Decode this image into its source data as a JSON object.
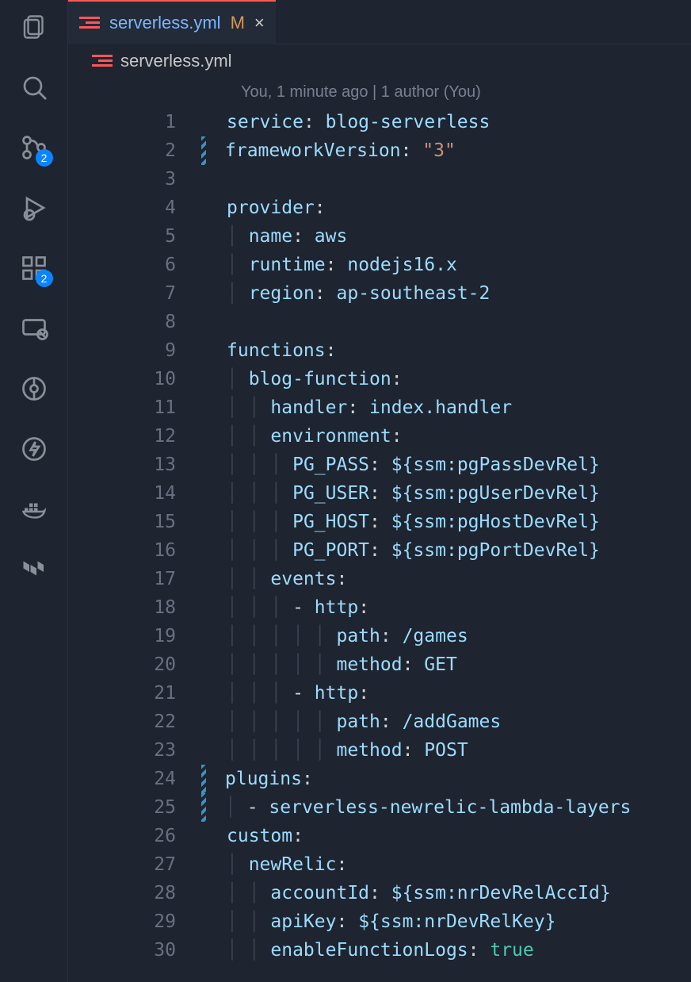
{
  "tab": {
    "filename": "serverless.yml",
    "modified_badge": "M",
    "close_glyph": "×"
  },
  "breadcrumb": {
    "filename": "serverless.yml"
  },
  "activity": {
    "scm_badge": "2",
    "ext_badge": "2"
  },
  "codelens": "You, 1 minute ago | 1 author (You)",
  "code": {
    "line1": [
      [
        "key",
        "service"
      ],
      [
        "punc",
        ": "
      ],
      [
        "plain",
        "blog-serverless"
      ]
    ],
    "line2": [
      [
        "key",
        "frameworkVersion"
      ],
      [
        "punc",
        ": "
      ],
      [
        "str",
        "\"3\""
      ]
    ],
    "line3": [],
    "line4": [
      [
        "key",
        "provider"
      ],
      [
        "punc",
        ":"
      ]
    ],
    "line5": [
      [
        "indent",
        "  "
      ],
      [
        "key",
        "name"
      ],
      [
        "punc",
        ": "
      ],
      [
        "plain",
        "aws"
      ]
    ],
    "line6": [
      [
        "indent",
        "  "
      ],
      [
        "key",
        "runtime"
      ],
      [
        "punc",
        ": "
      ],
      [
        "plain",
        "nodejs16.x"
      ]
    ],
    "line7": [
      [
        "indent",
        "  "
      ],
      [
        "key",
        "region"
      ],
      [
        "punc",
        ": "
      ],
      [
        "plain",
        "ap-southeast-2"
      ]
    ],
    "line8": [],
    "line9": [
      [
        "key",
        "functions"
      ],
      [
        "punc",
        ":"
      ]
    ],
    "line10": [
      [
        "indent",
        "  "
      ],
      [
        "key",
        "blog-function"
      ],
      [
        "punc",
        ":"
      ]
    ],
    "line11": [
      [
        "indent",
        "    "
      ],
      [
        "key",
        "handler"
      ],
      [
        "punc",
        ": "
      ],
      [
        "plain",
        "index.handler"
      ]
    ],
    "line12": [
      [
        "indent",
        "    "
      ],
      [
        "key",
        "environment"
      ],
      [
        "punc",
        ":"
      ]
    ],
    "line13": [
      [
        "indent",
        "      "
      ],
      [
        "key",
        "PG_PASS"
      ],
      [
        "punc",
        ": "
      ],
      [
        "ssm",
        "${ssm:pgPassDevRel}"
      ]
    ],
    "line14": [
      [
        "indent",
        "      "
      ],
      [
        "key",
        "PG_USER"
      ],
      [
        "punc",
        ": "
      ],
      [
        "ssm",
        "${ssm:pgUserDevRel}"
      ]
    ],
    "line15": [
      [
        "indent",
        "      "
      ],
      [
        "key",
        "PG_HOST"
      ],
      [
        "punc",
        ": "
      ],
      [
        "ssm",
        "${ssm:pgHostDevRel}"
      ]
    ],
    "line16": [
      [
        "indent",
        "      "
      ],
      [
        "key",
        "PG_PORT"
      ],
      [
        "punc",
        ": "
      ],
      [
        "ssm",
        "${ssm:pgPortDevRel}"
      ]
    ],
    "line17": [
      [
        "indent",
        "    "
      ],
      [
        "key",
        "events"
      ],
      [
        "punc",
        ":"
      ]
    ],
    "line18": [
      [
        "indent",
        "      "
      ],
      [
        "dash",
        "- "
      ],
      [
        "key",
        "http"
      ],
      [
        "punc",
        ":"
      ]
    ],
    "line19": [
      [
        "indent",
        "          "
      ],
      [
        "key",
        "path"
      ],
      [
        "punc",
        ": "
      ],
      [
        "plain",
        "/games"
      ]
    ],
    "line20": [
      [
        "indent",
        "          "
      ],
      [
        "key",
        "method"
      ],
      [
        "punc",
        ": "
      ],
      [
        "plain",
        "GET"
      ]
    ],
    "line21": [
      [
        "indent",
        "      "
      ],
      [
        "dash",
        "- "
      ],
      [
        "key",
        "http"
      ],
      [
        "punc",
        ":"
      ]
    ],
    "line22": [
      [
        "indent",
        "          "
      ],
      [
        "key",
        "path"
      ],
      [
        "punc",
        ": "
      ],
      [
        "plain",
        "/addGames"
      ]
    ],
    "line23": [
      [
        "indent",
        "          "
      ],
      [
        "key",
        "method"
      ],
      [
        "punc",
        ": "
      ],
      [
        "plain",
        "POST"
      ]
    ],
    "line24": [
      [
        "key",
        "plugins"
      ],
      [
        "punc",
        ":"
      ]
    ],
    "line25": [
      [
        "indent",
        "  "
      ],
      [
        "dash",
        "- "
      ],
      [
        "plain",
        "serverless-newrelic-lambda-layers"
      ]
    ],
    "line26": [
      [
        "key",
        "custom"
      ],
      [
        "punc",
        ":"
      ]
    ],
    "line27": [
      [
        "indent",
        "  "
      ],
      [
        "key",
        "newRelic"
      ],
      [
        "punc",
        ":"
      ]
    ],
    "line28": [
      [
        "indent",
        "    "
      ],
      [
        "key",
        "accountId"
      ],
      [
        "punc",
        ": "
      ],
      [
        "ssm",
        "${ssm:nrDevRelAccId}"
      ]
    ],
    "line29": [
      [
        "indent",
        "    "
      ],
      [
        "key",
        "apiKey"
      ],
      [
        "punc",
        ": "
      ],
      [
        "ssm",
        "${ssm:nrDevRelKey}"
      ]
    ],
    "line30": [
      [
        "indent",
        "    "
      ],
      [
        "key",
        "enableFunctionLogs"
      ],
      [
        "punc",
        ": "
      ],
      [
        "bool",
        "true"
      ]
    ]
  },
  "line_meta": {
    "2": {
      "gutter": "mod"
    },
    "24": {
      "gutter": "mod"
    },
    "25": {
      "gutter": "mod"
    }
  }
}
